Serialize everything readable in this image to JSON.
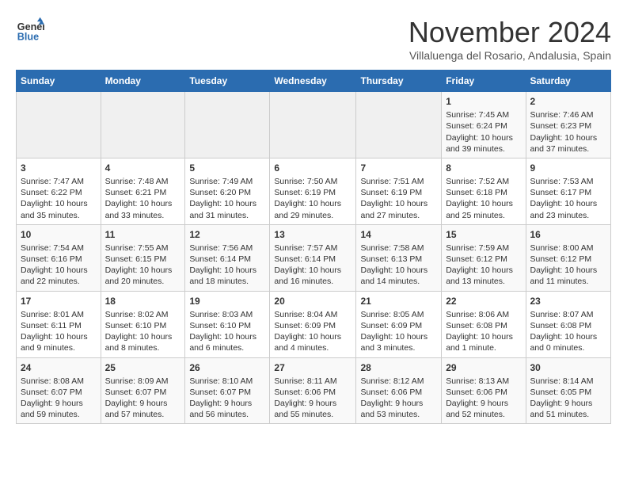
{
  "logo": {
    "line1": "General",
    "line2": "Blue"
  },
  "header": {
    "month": "November 2024",
    "location": "Villaluenga del Rosario, Andalusia, Spain"
  },
  "weekdays": [
    "Sunday",
    "Monday",
    "Tuesday",
    "Wednesday",
    "Thursday",
    "Friday",
    "Saturday"
  ],
  "weeks": [
    [
      {
        "day": "",
        "content": ""
      },
      {
        "day": "",
        "content": ""
      },
      {
        "day": "",
        "content": ""
      },
      {
        "day": "",
        "content": ""
      },
      {
        "day": "",
        "content": ""
      },
      {
        "day": "1",
        "content": "Sunrise: 7:45 AM\nSunset: 6:24 PM\nDaylight: 10 hours and 39 minutes."
      },
      {
        "day": "2",
        "content": "Sunrise: 7:46 AM\nSunset: 6:23 PM\nDaylight: 10 hours and 37 minutes."
      }
    ],
    [
      {
        "day": "3",
        "content": "Sunrise: 7:47 AM\nSunset: 6:22 PM\nDaylight: 10 hours and 35 minutes."
      },
      {
        "day": "4",
        "content": "Sunrise: 7:48 AM\nSunset: 6:21 PM\nDaylight: 10 hours and 33 minutes."
      },
      {
        "day": "5",
        "content": "Sunrise: 7:49 AM\nSunset: 6:20 PM\nDaylight: 10 hours and 31 minutes."
      },
      {
        "day": "6",
        "content": "Sunrise: 7:50 AM\nSunset: 6:19 PM\nDaylight: 10 hours and 29 minutes."
      },
      {
        "day": "7",
        "content": "Sunrise: 7:51 AM\nSunset: 6:19 PM\nDaylight: 10 hours and 27 minutes."
      },
      {
        "day": "8",
        "content": "Sunrise: 7:52 AM\nSunset: 6:18 PM\nDaylight: 10 hours and 25 minutes."
      },
      {
        "day": "9",
        "content": "Sunrise: 7:53 AM\nSunset: 6:17 PM\nDaylight: 10 hours and 23 minutes."
      }
    ],
    [
      {
        "day": "10",
        "content": "Sunrise: 7:54 AM\nSunset: 6:16 PM\nDaylight: 10 hours and 22 minutes."
      },
      {
        "day": "11",
        "content": "Sunrise: 7:55 AM\nSunset: 6:15 PM\nDaylight: 10 hours and 20 minutes."
      },
      {
        "day": "12",
        "content": "Sunrise: 7:56 AM\nSunset: 6:14 PM\nDaylight: 10 hours and 18 minutes."
      },
      {
        "day": "13",
        "content": "Sunrise: 7:57 AM\nSunset: 6:14 PM\nDaylight: 10 hours and 16 minutes."
      },
      {
        "day": "14",
        "content": "Sunrise: 7:58 AM\nSunset: 6:13 PM\nDaylight: 10 hours and 14 minutes."
      },
      {
        "day": "15",
        "content": "Sunrise: 7:59 AM\nSunset: 6:12 PM\nDaylight: 10 hours and 13 minutes."
      },
      {
        "day": "16",
        "content": "Sunrise: 8:00 AM\nSunset: 6:12 PM\nDaylight: 10 hours and 11 minutes."
      }
    ],
    [
      {
        "day": "17",
        "content": "Sunrise: 8:01 AM\nSunset: 6:11 PM\nDaylight: 10 hours and 9 minutes."
      },
      {
        "day": "18",
        "content": "Sunrise: 8:02 AM\nSunset: 6:10 PM\nDaylight: 10 hours and 8 minutes."
      },
      {
        "day": "19",
        "content": "Sunrise: 8:03 AM\nSunset: 6:10 PM\nDaylight: 10 hours and 6 minutes."
      },
      {
        "day": "20",
        "content": "Sunrise: 8:04 AM\nSunset: 6:09 PM\nDaylight: 10 hours and 4 minutes."
      },
      {
        "day": "21",
        "content": "Sunrise: 8:05 AM\nSunset: 6:09 PM\nDaylight: 10 hours and 3 minutes."
      },
      {
        "day": "22",
        "content": "Sunrise: 8:06 AM\nSunset: 6:08 PM\nDaylight: 10 hours and 1 minute."
      },
      {
        "day": "23",
        "content": "Sunrise: 8:07 AM\nSunset: 6:08 PM\nDaylight: 10 hours and 0 minutes."
      }
    ],
    [
      {
        "day": "24",
        "content": "Sunrise: 8:08 AM\nSunset: 6:07 PM\nDaylight: 9 hours and 59 minutes."
      },
      {
        "day": "25",
        "content": "Sunrise: 8:09 AM\nSunset: 6:07 PM\nDaylight: 9 hours and 57 minutes."
      },
      {
        "day": "26",
        "content": "Sunrise: 8:10 AM\nSunset: 6:07 PM\nDaylight: 9 hours and 56 minutes."
      },
      {
        "day": "27",
        "content": "Sunrise: 8:11 AM\nSunset: 6:06 PM\nDaylight: 9 hours and 55 minutes."
      },
      {
        "day": "28",
        "content": "Sunrise: 8:12 AM\nSunset: 6:06 PM\nDaylight: 9 hours and 53 minutes."
      },
      {
        "day": "29",
        "content": "Sunrise: 8:13 AM\nSunset: 6:06 PM\nDaylight: 9 hours and 52 minutes."
      },
      {
        "day": "30",
        "content": "Sunrise: 8:14 AM\nSunset: 6:05 PM\nDaylight: 9 hours and 51 minutes."
      }
    ]
  ]
}
